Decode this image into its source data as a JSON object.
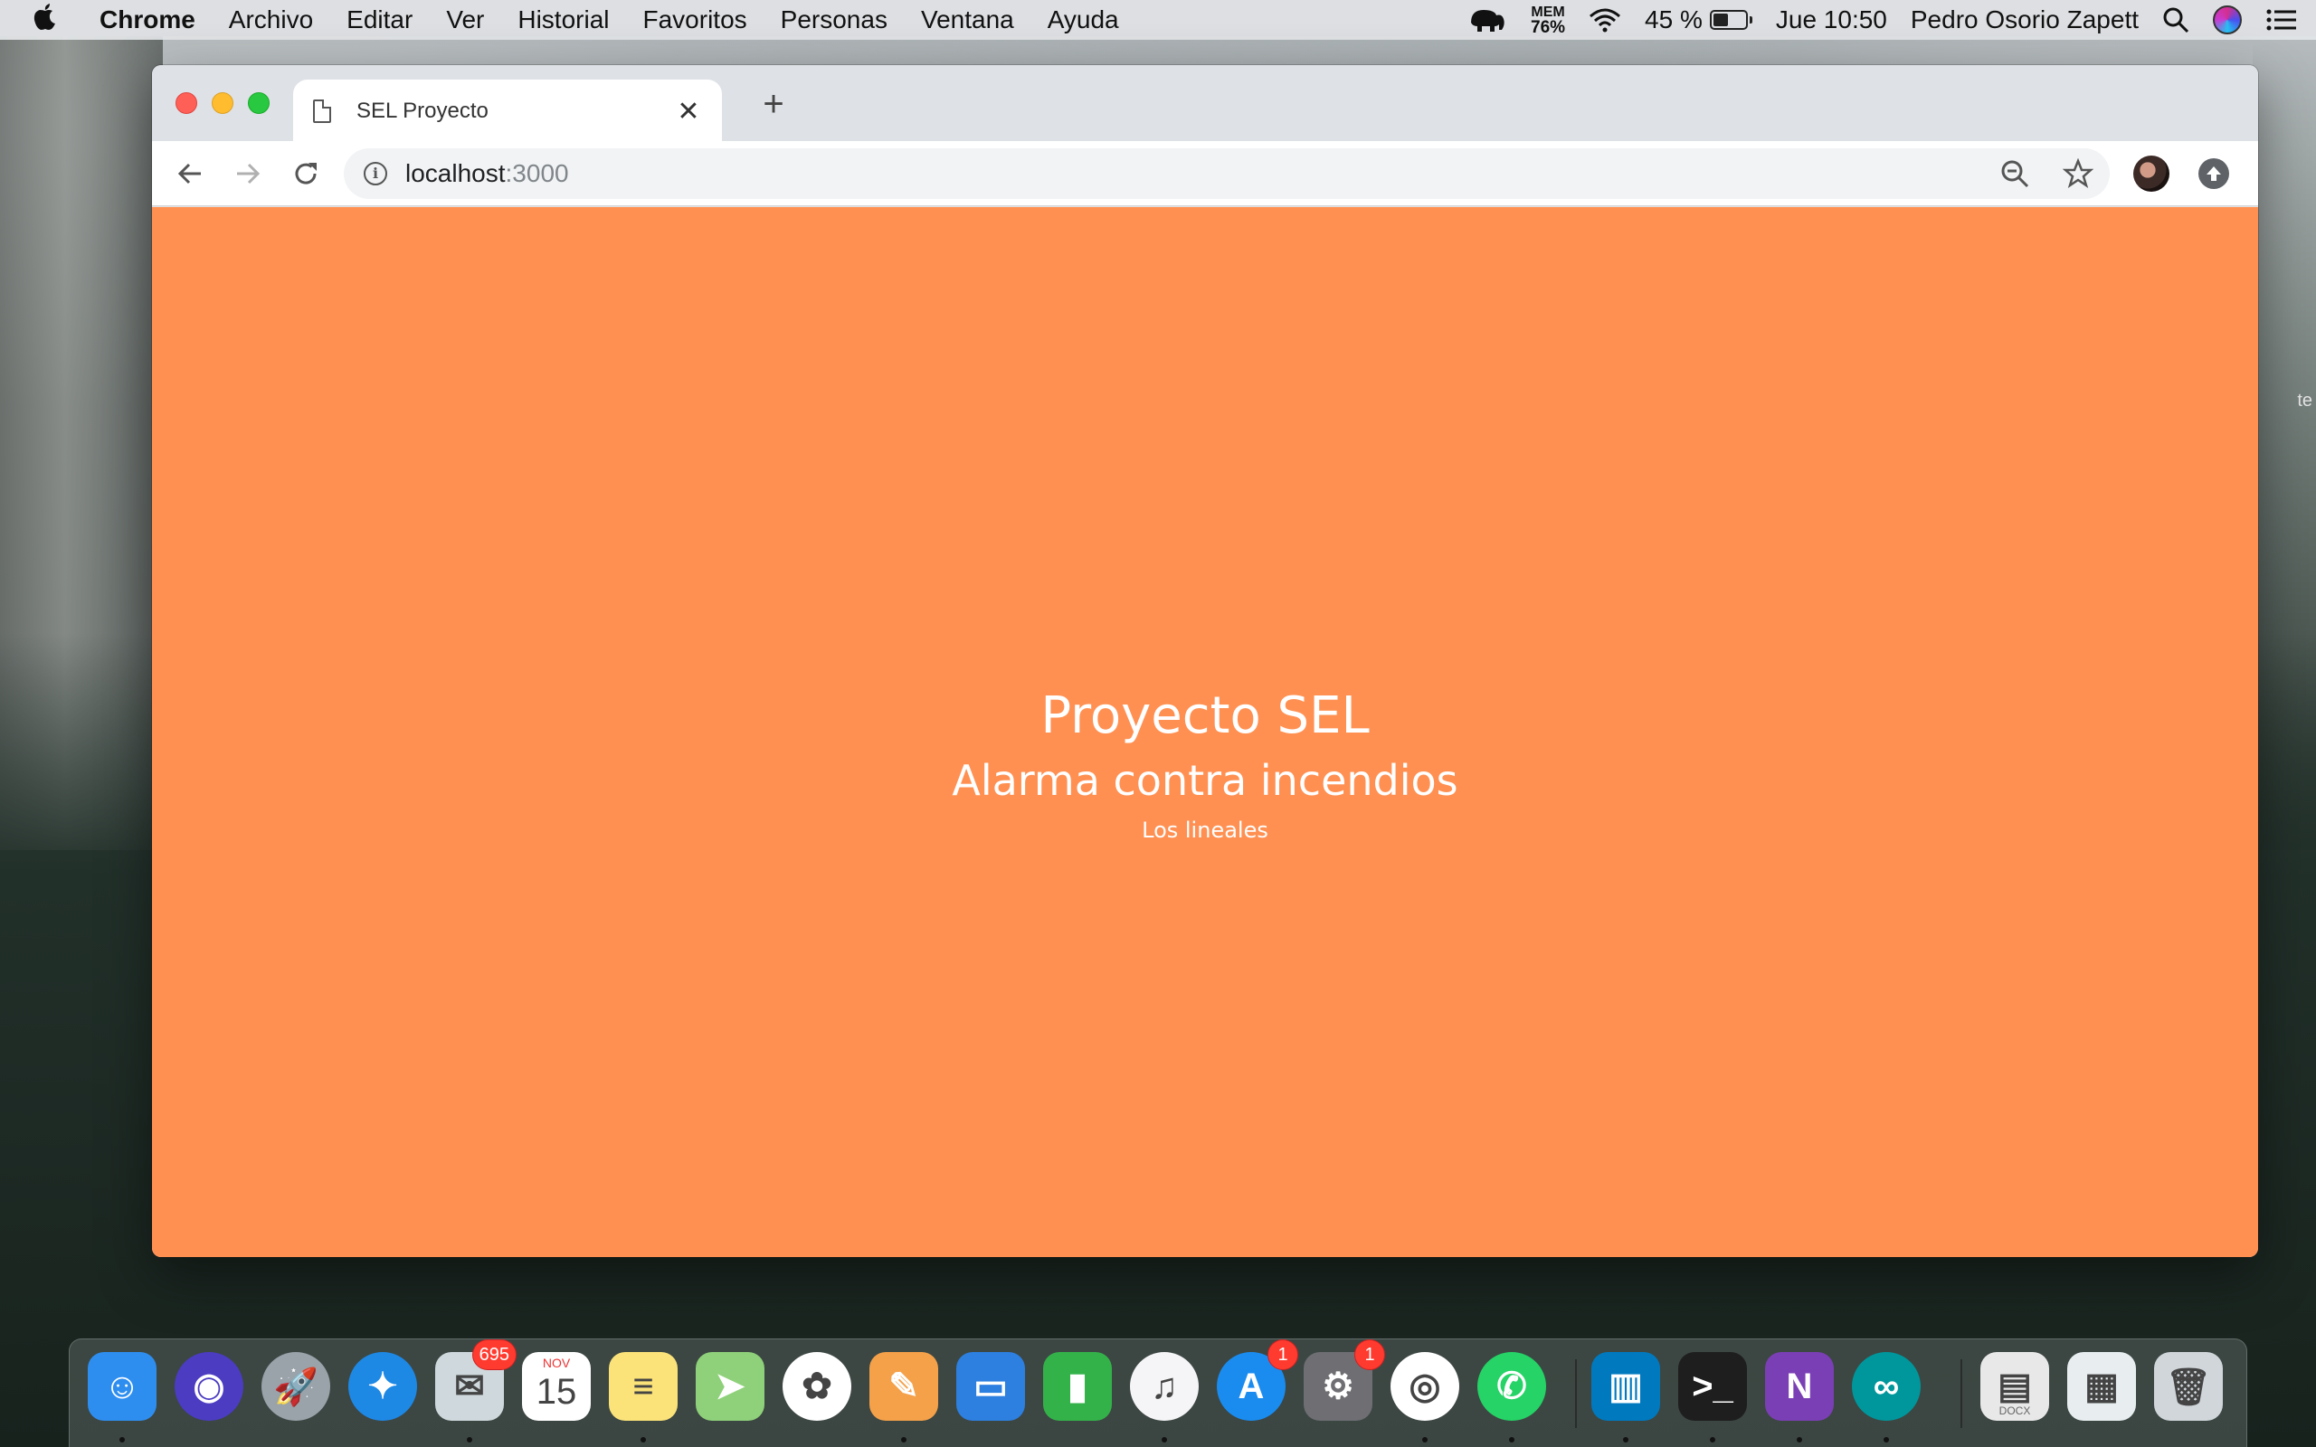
{
  "menubar": {
    "app_name": "Chrome",
    "menus": [
      "Archivo",
      "Editar",
      "Ver",
      "Historial",
      "Favoritos",
      "Personas",
      "Ventana",
      "Ayuda"
    ],
    "mem_label": "MEM",
    "mem_value": "76%",
    "battery_percent": "45 %",
    "battery_level": 0.45,
    "datetime": "Jue 10:50",
    "user": "Pedro Osorio Zapett"
  },
  "browser": {
    "tab_title": "SEL Proyecto",
    "tab_close": "✕",
    "new_tab": "+",
    "url_host": "localhost",
    "url_port": ":3000"
  },
  "page": {
    "title": "Proyecto SEL",
    "subtitle": "Alarma contra incendios",
    "team": "Los lineales",
    "background_color": "#ff9052"
  },
  "desktop": {
    "edge_text": "te"
  },
  "dock": {
    "apps": [
      {
        "name": "finder",
        "color": "#2e8ef0",
        "glyph": "☺",
        "running": true
      },
      {
        "name": "siri",
        "color": "#4b3cc2",
        "glyph": "◉",
        "running": false
      },
      {
        "name": "launchpad",
        "color": "#9aa2aa",
        "glyph": "🚀",
        "running": false
      },
      {
        "name": "safari",
        "color": "#1e88e5",
        "glyph": "✦",
        "running": false
      },
      {
        "name": "mail",
        "color": "#cfd8dc",
        "glyph": "✉",
        "running": true,
        "badge": "695"
      },
      {
        "name": "calendar",
        "color": "#ffffff",
        "glyph": "15",
        "running": false,
        "label_top": "NOV"
      },
      {
        "name": "notes",
        "color": "#fbe37a",
        "glyph": "≡",
        "running": true
      },
      {
        "name": "maps",
        "color": "#8fd17a",
        "glyph": "➤",
        "running": false
      },
      {
        "name": "photos",
        "color": "#ffffff",
        "glyph": "✿",
        "running": false
      },
      {
        "name": "pages",
        "color": "#f4a14a",
        "glyph": "✎",
        "running": true
      },
      {
        "name": "keynote",
        "color": "#2d7fe0",
        "glyph": "▭",
        "running": false
      },
      {
        "name": "numbers",
        "color": "#34b24a",
        "glyph": "▮",
        "running": false
      },
      {
        "name": "itunes",
        "color": "#f5f5f7",
        "glyph": "♫",
        "running": true
      },
      {
        "name": "app-store",
        "color": "#1a8cf0",
        "glyph": "A",
        "running": false,
        "badge": "1"
      },
      {
        "name": "system-preferences",
        "color": "#6e6e73",
        "glyph": "⚙",
        "running": false,
        "badge": "1"
      },
      {
        "name": "chrome",
        "color": "#ffffff",
        "glyph": "◎",
        "running": true
      },
      {
        "name": "whatsapp",
        "color": "#25d366",
        "glyph": "✆",
        "running": true
      },
      {
        "name": "trello",
        "color": "#0079bf",
        "glyph": "▥",
        "running": true
      },
      {
        "name": "terminal",
        "color": "#1e1e1e",
        "glyph": ">_",
        "running": true
      },
      {
        "name": "onenote",
        "color": "#7b3fb5",
        "glyph": "N",
        "running": true
      },
      {
        "name": "arduino",
        "color": "#00979c",
        "glyph": "∞",
        "running": true
      },
      {
        "name": "docx-file",
        "color": "#e8e8e8",
        "glyph": "▤",
        "running": false,
        "label_bottom": "DOCX"
      },
      {
        "name": "arduino-sketch",
        "color": "#e8eef0",
        "glyph": "▦",
        "running": false
      },
      {
        "name": "trash",
        "color": "#d0d6da",
        "glyph": "🗑",
        "running": false
      }
    ]
  }
}
